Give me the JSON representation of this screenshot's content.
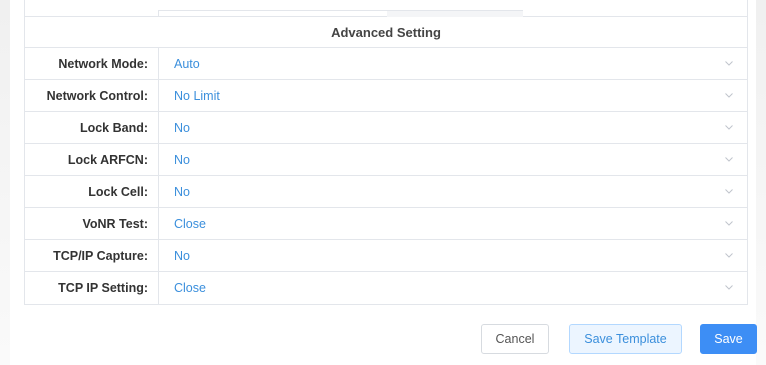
{
  "panel": {
    "title": "Advanced Setting",
    "rows": [
      {
        "label": "Network Mode:",
        "value": "Auto"
      },
      {
        "label": "Network Control:",
        "value": "No Limit"
      },
      {
        "label": "Lock Band:",
        "value": "No"
      },
      {
        "label": "Lock ARFCN:",
        "value": "No"
      },
      {
        "label": "Lock Cell:",
        "value": "No"
      },
      {
        "label": "VoNR Test:",
        "value": "Close"
      },
      {
        "label": "TCP/IP Capture:",
        "value": "No"
      },
      {
        "label": "TCP IP Setting:",
        "value": "Close"
      }
    ]
  },
  "footer": {
    "cancel_label": "Cancel",
    "save_template_label": "Save Template",
    "save_label": "Save"
  },
  "colors": {
    "accent": "#3d8ef5",
    "value_text": "#3b8fdc",
    "border": "#e3e6eb"
  },
  "icons": {
    "dropdown": "chevron-down-icon"
  }
}
